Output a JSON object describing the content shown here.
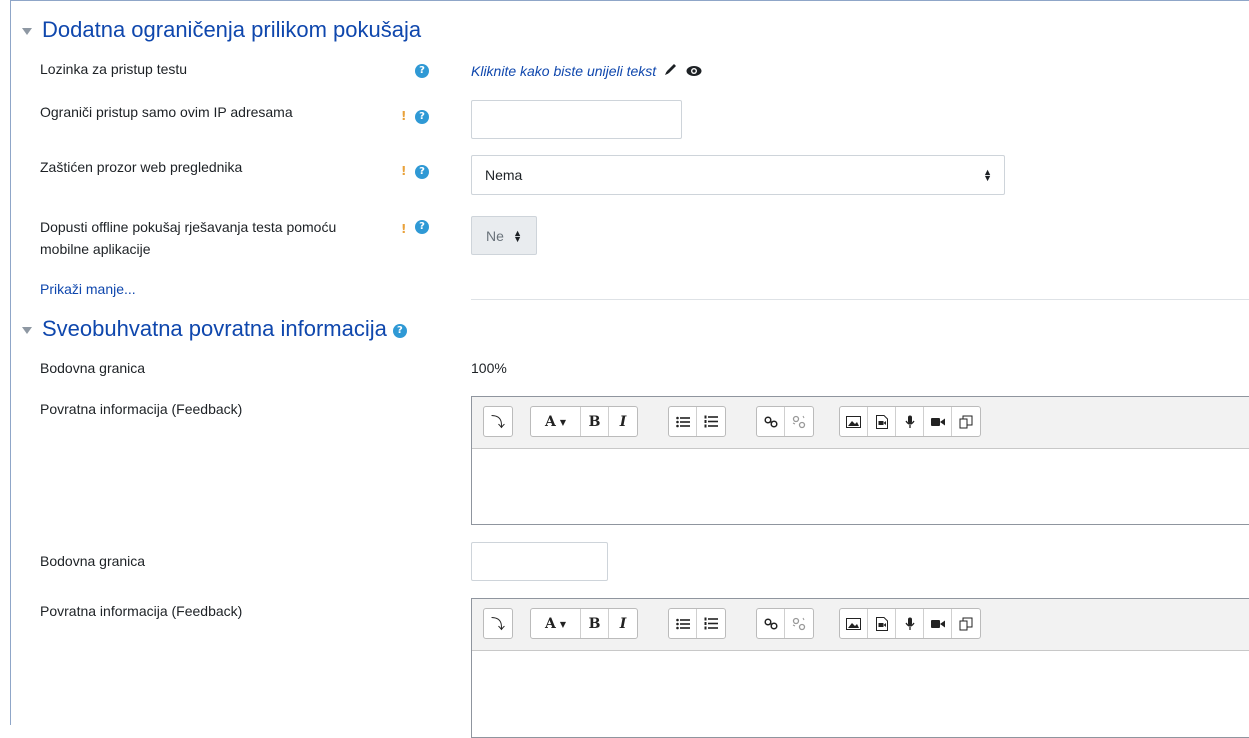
{
  "section1": {
    "title": "Dodatna ograničenja prilikom pokušaja",
    "password": {
      "label": "Lozinka za pristup testu",
      "editable_text": "Kliknite kako biste unijeli tekst"
    },
    "ip": {
      "label": "Ograniči pristup samo ovim IP adresama",
      "value": ""
    },
    "browser_security": {
      "label": "Zaštićen prozor web preglednika",
      "selected": "Nema"
    },
    "offline": {
      "label_line1": "Dopusti offline pokušaj rješavanja testa pomoću",
      "label_line2": "mobilne aplikacije",
      "selected": "Ne"
    },
    "show_less": "Prikaži manje..."
  },
  "section2": {
    "title": "Sveobuhvatna povratna informacija",
    "boundary1": {
      "label": "Bodovna granica",
      "value": "100%"
    },
    "feedback1": {
      "label": "Povratna informacija (Feedback)"
    },
    "boundary2": {
      "label": "Bodovna granica",
      "value": ""
    },
    "feedback2": {
      "label": "Povratna informacija (Feedback)"
    }
  },
  "icons": {
    "help": "?",
    "advanced": "!",
    "pencil": "✎",
    "eye": "👁"
  },
  "toolbar": {
    "toggle": "⤵",
    "font": "A",
    "bold": "B",
    "italic": "I"
  },
  "colors": {
    "section_title": "#0f47ad",
    "help_icon": "#2f99d5",
    "advanced_icon": "#e9a23b"
  }
}
